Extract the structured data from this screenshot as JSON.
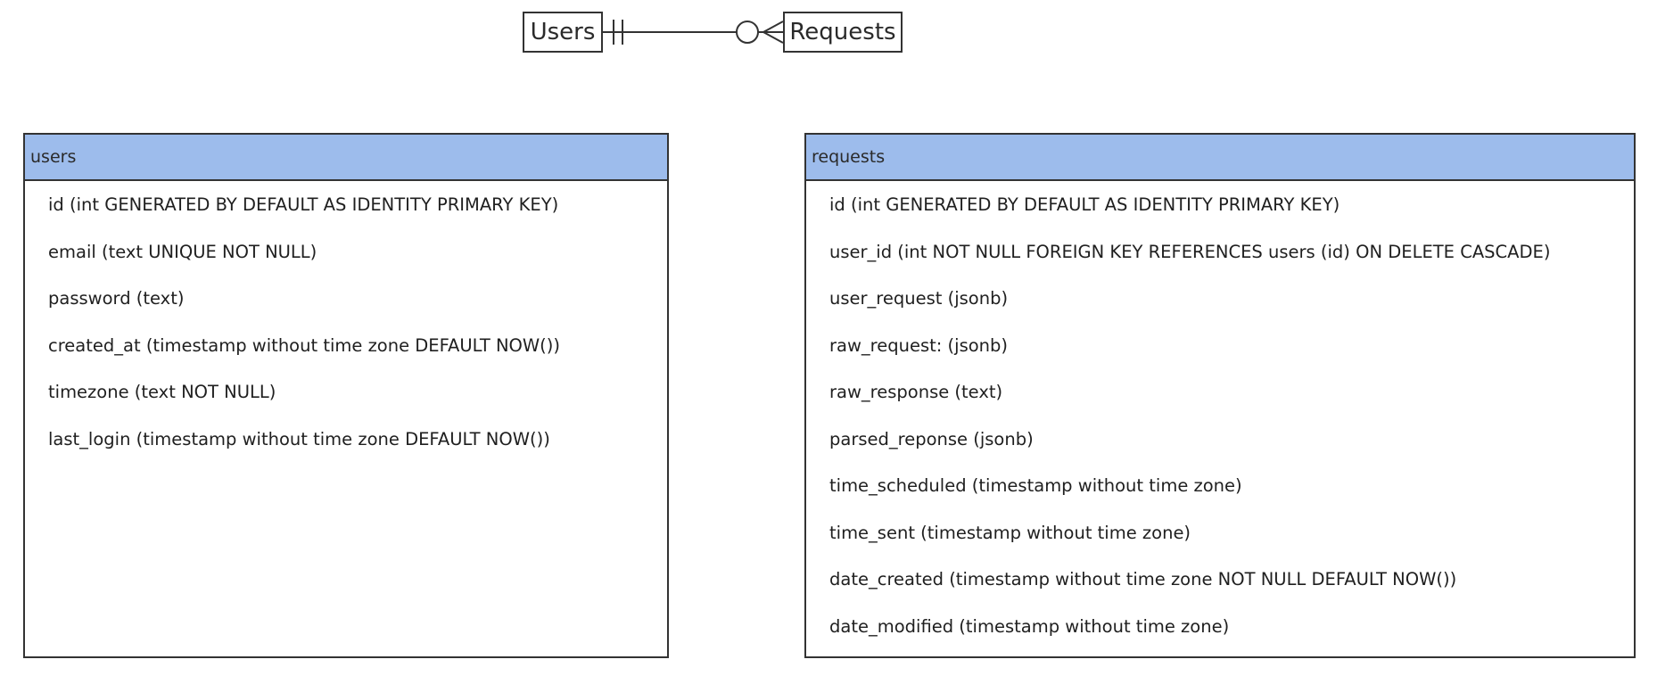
{
  "colors": {
    "header_fill": "#9dbcec",
    "border": "#333333"
  },
  "relationship": {
    "from": "Users",
    "to": "Requests",
    "from_cardinality": "exactly-one",
    "to_cardinality": "zero-or-many"
  },
  "tables": {
    "users": {
      "name": "users",
      "columns": [
        "id (int GENERATED BY DEFAULT AS IDENTITY PRIMARY KEY)",
        "email (text UNIQUE NOT NULL)",
        "password (text)",
        "created_at (timestamp without time zone DEFAULT NOW())",
        "timezone (text NOT NULL)",
        "last_login (timestamp without time zone DEFAULT NOW())"
      ]
    },
    "requests": {
      "name": "requests",
      "columns": [
        "id (int GENERATED BY DEFAULT AS IDENTITY PRIMARY KEY)",
        "user_id (int NOT NULL FOREIGN KEY REFERENCES users (id) ON DELETE CASCADE)",
        "user_request (jsonb)",
        "raw_request: (jsonb)",
        "raw_response (text)",
        "parsed_reponse (jsonb)",
        "time_scheduled (timestamp without time zone)",
        "time_sent (timestamp without time zone)",
        "date_created (timestamp without time zone NOT NULL DEFAULT NOW())",
        "date_modified (timestamp without time zone)"
      ]
    }
  }
}
